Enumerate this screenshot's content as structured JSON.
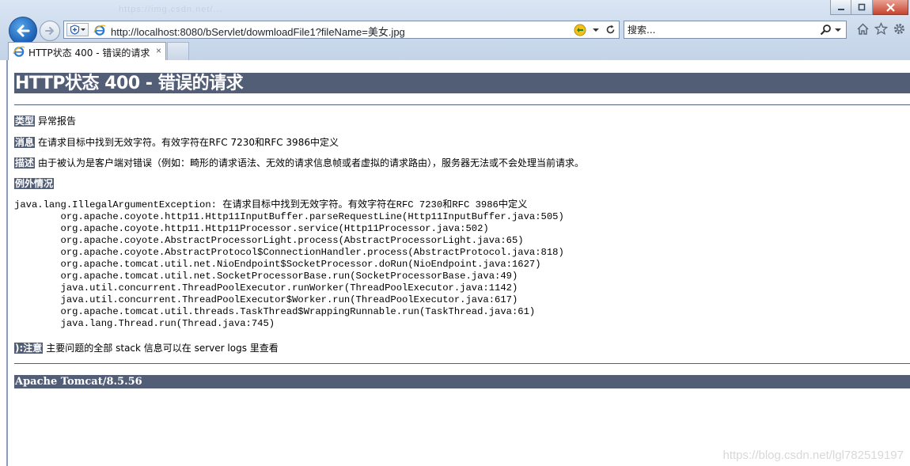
{
  "browser": {
    "window_title": "https://img.csdn.net/...",
    "address_url": "http://localhost:8080/bServlet/dowmloadFile1?fileName=美女.jpg",
    "search_placeholder": "搜索...",
    "tab_title": "HTTP状态 400 - 错误的请求",
    "tab_close": "×"
  },
  "page": {
    "title": "HTTP状态 400 - 错误的请求",
    "type_label": "类型",
    "type_value": "异常报告",
    "message_label": "消息",
    "message_value": "在请求目标中找到无效字符。有效字符在RFC 7230和RFC 3986中定义",
    "description_label": "描述",
    "description_value": "由于被认为是客户端对错误（例如：畸形的请求语法、无效的请求信息帧或者虚拟的请求路由），服务器无法或不会处理当前请求。",
    "exception_label": "例外情况",
    "stack_trace": "java.lang.IllegalArgumentException: 在请求目标中找到无效字符。有效字符在RFC 7230和RFC 3986中定义\n\torg.apache.coyote.http11.Http11InputBuffer.parseRequestLine(Http11InputBuffer.java:505)\n\torg.apache.coyote.http11.Http11Processor.service(Http11Processor.java:502)\n\torg.apache.coyote.AbstractProcessorLight.process(AbstractProcessorLight.java:65)\n\torg.apache.coyote.AbstractProtocol$ConnectionHandler.process(AbstractProtocol.java:818)\n\torg.apache.tomcat.util.net.NioEndpoint$SocketProcessor.doRun(NioEndpoint.java:1627)\n\torg.apache.tomcat.util.net.SocketProcessorBase.run(SocketProcessorBase.java:49)\n\tjava.util.concurrent.ThreadPoolExecutor.runWorker(ThreadPoolExecutor.java:1142)\n\tjava.util.concurrent.ThreadPoolExecutor$Worker.run(ThreadPoolExecutor.java:617)\n\torg.apache.tomcat.util.threads.TaskThread$WrappingRunnable.run(TaskThread.java:61)\n\tjava.lang.Thread.run(Thread.java:745)",
    "note_label": "):注意",
    "note_value": "主要问题的全部 stack 信息可以在 server logs 里查看",
    "server_info": "Apache Tomcat/8.5.56"
  },
  "watermark": "https://blog.csdn.net/lgl782519197",
  "colors": {
    "tomcat_bar": "#525d76",
    "back_button": "#1c5fb3"
  },
  "icons": [
    "back-arrow-icon",
    "forward-arrow-icon",
    "compatibility-icon",
    "ie-logo-icon",
    "refresh-icon",
    "search-icon",
    "home-icon",
    "favorites-star-icon",
    "gear-icon"
  ]
}
